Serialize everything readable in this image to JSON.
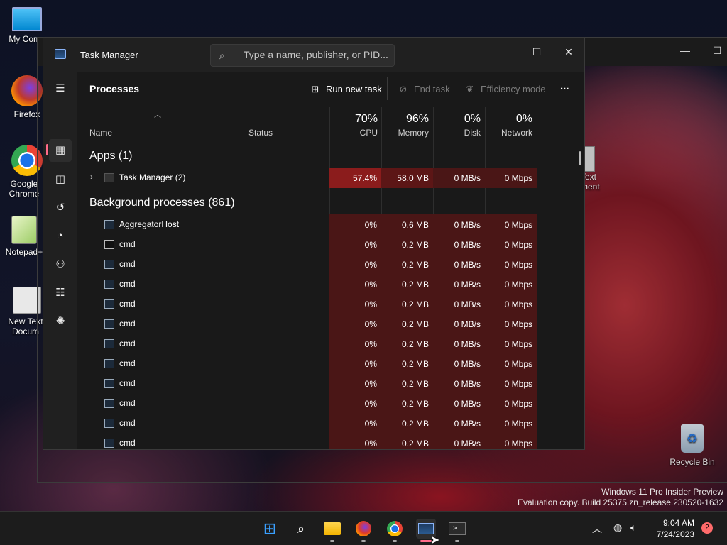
{
  "desktop": {
    "icons": [
      {
        "label": "My Comp",
        "icon": "monitor-icon"
      },
      {
        "label": "Firefox",
        "icon": "firefox-icon"
      },
      {
        "label": "Google Chrome",
        "icon": "chrome-icon"
      },
      {
        "label": "Notepad+",
        "icon": "notepadpp-icon"
      },
      {
        "label": "New Text Docum",
        "icon": "textdoc-icon"
      }
    ],
    "partial_label": "Text\nment",
    "recycle_bin": "Recycle Bin"
  },
  "task_manager": {
    "title": "Task Manager",
    "search_placeholder": "Type a name, publisher, or PID...",
    "page_title": "Processes",
    "toolbar": {
      "run_new_task": "Run new task",
      "end_task": "End task",
      "efficiency_mode": "Efficiency mode",
      "more": "..."
    },
    "columns": {
      "name": "Name",
      "status": "Status",
      "cpu_pct": "70%",
      "cpu": "CPU",
      "memory_pct": "96%",
      "memory": "Memory",
      "disk_pct": "0%",
      "disk": "Disk",
      "network_pct": "0%",
      "network": "Network"
    },
    "apps_header": "Apps (1)",
    "apps": [
      {
        "name": "Task Manager (2)",
        "cpu": "57.4%",
        "memory": "58.0 MB",
        "disk": "0 MB/s",
        "network": "0 Mbps"
      }
    ],
    "background_header": "Background processes (861)",
    "background": [
      {
        "name": "AggregatorHost",
        "icon": "app",
        "cpu": "0%",
        "memory": "0.6 MB",
        "disk": "0 MB/s",
        "network": "0 Mbps"
      },
      {
        "name": "cmd",
        "icon": "cmd",
        "cpu": "0%",
        "memory": "0.2 MB",
        "disk": "0 MB/s",
        "network": "0 Mbps"
      },
      {
        "name": "cmd",
        "icon": "app",
        "cpu": "0%",
        "memory": "0.2 MB",
        "disk": "0 MB/s",
        "network": "0 Mbps"
      },
      {
        "name": "cmd",
        "icon": "app",
        "cpu": "0%",
        "memory": "0.2 MB",
        "disk": "0 MB/s",
        "network": "0 Mbps"
      },
      {
        "name": "cmd",
        "icon": "app",
        "cpu": "0%",
        "memory": "0.2 MB",
        "disk": "0 MB/s",
        "network": "0 Mbps"
      },
      {
        "name": "cmd",
        "icon": "app",
        "cpu": "0%",
        "memory": "0.2 MB",
        "disk": "0 MB/s",
        "network": "0 Mbps"
      },
      {
        "name": "cmd",
        "icon": "app",
        "cpu": "0%",
        "memory": "0.2 MB",
        "disk": "0 MB/s",
        "network": "0 Mbps"
      },
      {
        "name": "cmd",
        "icon": "app",
        "cpu": "0%",
        "memory": "0.2 MB",
        "disk": "0 MB/s",
        "network": "0 Mbps"
      },
      {
        "name": "cmd",
        "icon": "app",
        "cpu": "0%",
        "memory": "0.2 MB",
        "disk": "0 MB/s",
        "network": "0 Mbps"
      },
      {
        "name": "cmd",
        "icon": "app",
        "cpu": "0%",
        "memory": "0.2 MB",
        "disk": "0 MB/s",
        "network": "0 Mbps"
      },
      {
        "name": "cmd",
        "icon": "app",
        "cpu": "0%",
        "memory": "0.2 MB",
        "disk": "0 MB/s",
        "network": "0 Mbps"
      },
      {
        "name": "cmd",
        "icon": "app",
        "cpu": "0%",
        "memory": "0.2 MB",
        "disk": "0 MB/s",
        "network": "0 Mbps"
      }
    ]
  },
  "watermark": {
    "line1": "Windows 11 Pro Insider Preview",
    "line2": "Evaluation copy. Build 25375.zn_release.230520-1632"
  },
  "taskbar": {
    "time": "9:04 AM",
    "date": "7/24/2023",
    "notifications": "2"
  },
  "colors": {
    "accent": "#ff6b8a",
    "heat_high": "#8b1c1c",
    "heat_low": "#4a1616"
  }
}
